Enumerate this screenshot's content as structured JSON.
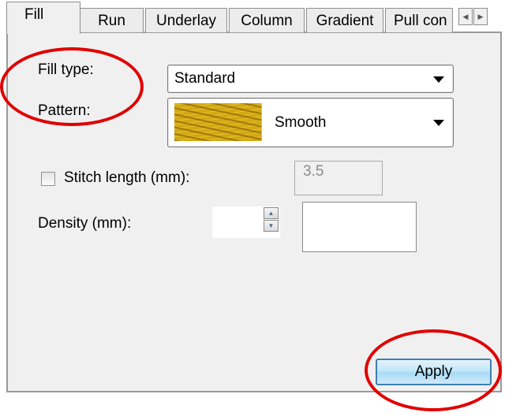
{
  "tabs": [
    {
      "label": "Fill",
      "active": true
    },
    {
      "label": "Run"
    },
    {
      "label": "Underlay"
    },
    {
      "label": "Column"
    },
    {
      "label": "Gradient"
    },
    {
      "label": "Pull con"
    }
  ],
  "tab_scroll": {
    "left_icon": "triangle-left-icon",
    "right_icon": "triangle-right-icon"
  },
  "fill_type": {
    "label": "Fill type:",
    "value": "Standard"
  },
  "pattern": {
    "label": "Pattern:",
    "value": "Smooth",
    "swatch_color": "#d4a814"
  },
  "stitch_length": {
    "label": "Stitch length (mm):",
    "checked": false,
    "value": "3.5"
  },
  "density": {
    "label": "Density (mm):",
    "value": ""
  },
  "apply_button": {
    "label": "Apply"
  },
  "annotation_color": "#e00000"
}
